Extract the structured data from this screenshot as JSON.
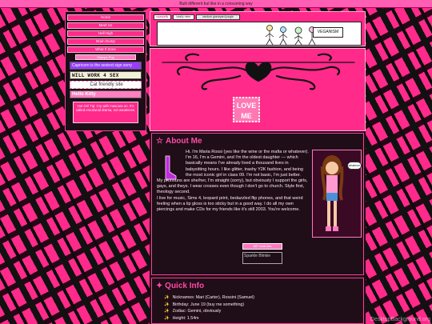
{
  "topbar": {
    "text": "Built different but like in a consuming way"
  },
  "nav": {
    "items": [
      "Home",
      "Meet Us",
      "Hell High",
      "Brain Dump",
      "What If Zone"
    ]
  },
  "sidebar": {
    "section_title": "Stamps Pop",
    "stamps": [
      "Capricorn is the sexiest sign sorry",
      "WILL WORK 4 SEX",
      "Cat friendly site",
      "Hello   Kitty"
    ],
    "hot_tip": "Hot Girl Tip: Cry with mascara on. It's called emotional drama, not weakness."
  },
  "header": {
    "mini_buttons": [
      "nyanpelly",
      "totally mine",
      "random graveyard jungle"
    ],
    "banner_badge": "VEGANISM",
    "stamp_text": "LOVE ME"
  },
  "about": {
    "title": "About Me",
    "paragraphs": [
      "Hi. I'm Maria Rossi (yes like the wine or the mafia or whatever). I'm 16, I'm a Gemini, and I'm the oldest daughter — which basically means I've already lived a thousand lives in babysitting hours. I like glitter, trashy Y2K fashion, and being the most iconic girl in class 09. I'm not basic, I'm just better.",
      "My pronouns are she/her, I'm straight (sorry), but obviously I support the girls, gays, and theys. I wear crosses even though I don't go to church. Style first, theology second.",
      "I live for music, Sims 4, leopard print, bedazzled flip phones, and that weird feeling when a lip gloss is too sticky but in a good way. I do all my own piercings and make CDs for my friends like it's still 2003. You're welcome."
    ],
    "speech": "whatever",
    "hits_label": "887 total hits",
    "sparkle_alt": "Sparkle Blinkie"
  },
  "quick": {
    "title": "Quick Info",
    "items": [
      "Nicknames: Mari (Carter), Rossini (Samuel)",
      "Birthday: June 19 (buy me something)",
      "Zodiac: Gemini, obviously",
      "Height: 1.54m"
    ]
  },
  "watermark": "DesktopBackground.org",
  "colors": {
    "accent": "#ff2a8a",
    "panel": "#1f0d18",
    "heading": "#ff4ba6"
  }
}
